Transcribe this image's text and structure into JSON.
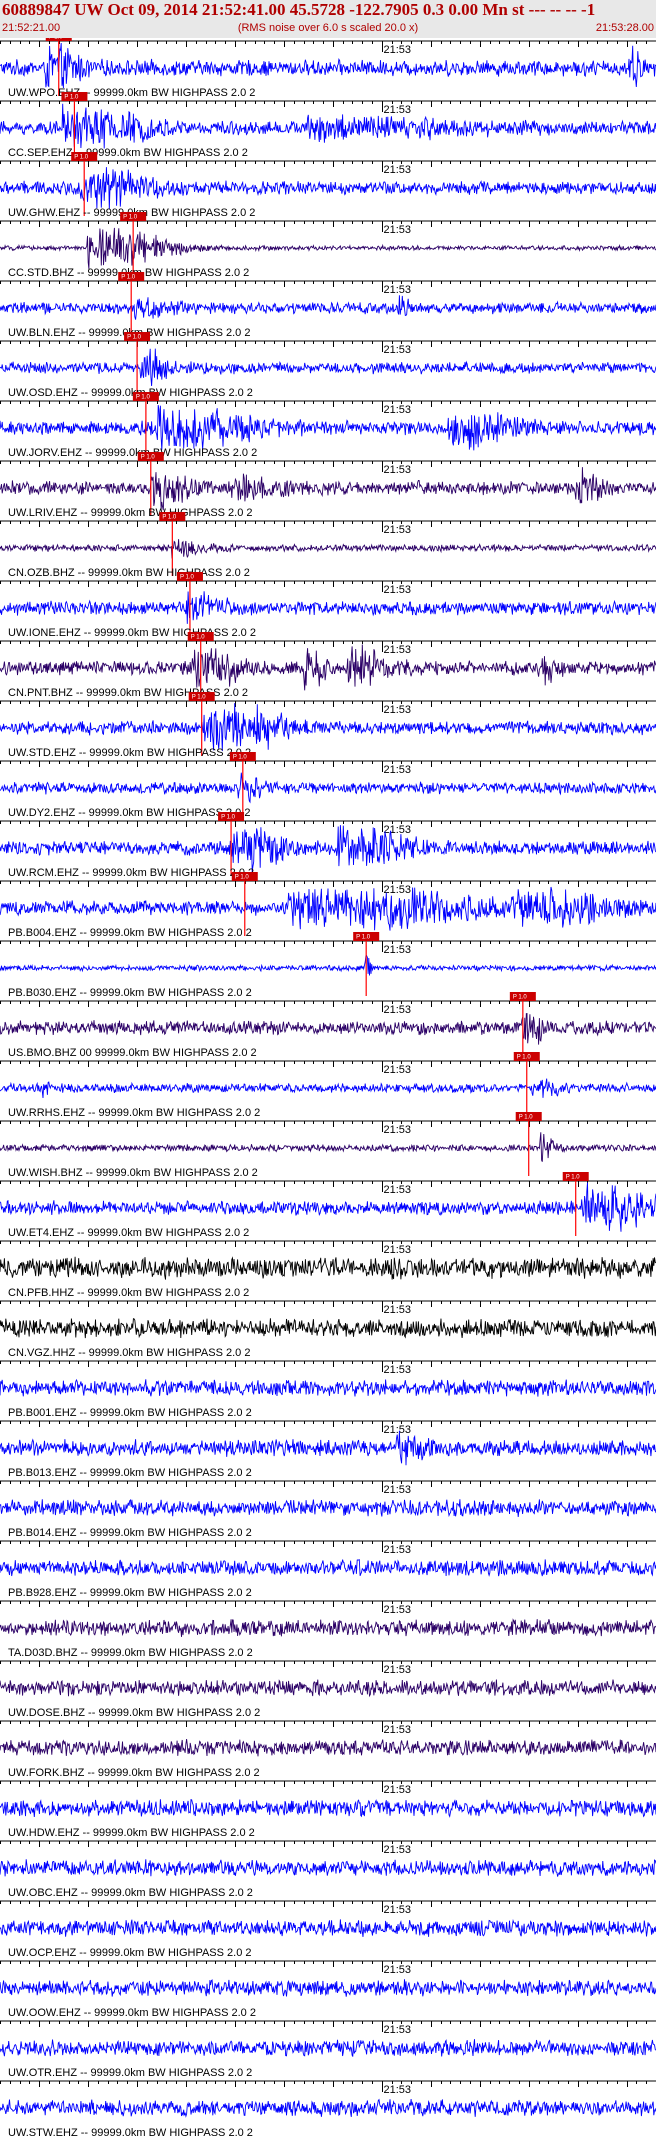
{
  "header": {
    "title": "60889847 UW Oct 09, 2014 21:52:41.00   45.5728 -122.7905  0.3 0.00 Mn st --- -- --   -1",
    "start_time": "21:52:21.00",
    "subtitle": "(RMS noise over 6.0 s scaled 20.0 x)",
    "end_time": "21:53:28.00"
  },
  "chart_data": {
    "type": "line",
    "x_range_seconds": [
      0,
      67
    ],
    "minute_mark_label": "21:53",
    "minute_mark_offset_s": 39,
    "traces": [
      {
        "label": "UW.WPO.EHZ -- 99999.0km BW  HIGHPASS  2.0  2",
        "pick_s": 6.0,
        "color": "#0000ff",
        "amp": 0.35,
        "events": [
          [
            5.5,
            1.0,
            2.5
          ],
          [
            64.5,
            1.0,
            0.8
          ]
        ]
      },
      {
        "label": "CC.SEP.EHZ -- 99999.0km BW  HIGHPASS  2.0  2",
        "pick_s": 7.6,
        "color": "#0000ff",
        "amp": 0.3,
        "events": [
          [
            8.5,
            0.8,
            6.0
          ],
          [
            35.5,
            0.35,
            12.0
          ]
        ]
      },
      {
        "label": "UW.GHW.EHZ -- 99999.0km BW  HIGHPASS  2.0  2",
        "pick_s": 8.6,
        "color": "#0000ff",
        "amp": 0.3,
        "events": [
          [
            10.0,
            0.7,
            5.0
          ]
        ]
      },
      {
        "label": "CC.STD.BHZ -- 99999.0km BW  HIGHPASS  2.0  2",
        "pick_s": 13.6,
        "color": "#2b0066",
        "amp": 0.1,
        "events": [
          [
            11.0,
            0.9,
            6.0
          ]
        ]
      },
      {
        "label": "UW.BLN.EHZ -- 99999.0km BW  HIGHPASS  2.0  2",
        "pick_s": 13.4,
        "color": "#0000ff",
        "amp": 0.25,
        "events": [
          [
            14.8,
            0.35,
            3.0
          ],
          [
            41.0,
            0.3,
            1.0
          ]
        ]
      },
      {
        "label": "UW.OSD.EHZ -- 99999.0km BW  HIGHPASS  2.0  2",
        "pick_s": 14.0,
        "color": "#0000ff",
        "amp": 0.25,
        "events": [
          [
            15.0,
            0.9,
            2.0
          ]
        ]
      },
      {
        "label": "UW.JORV.EHZ -- 99999.0km BW  HIGHPASS  2.0  2",
        "pick_s": 14.9,
        "color": "#0000ff",
        "amp": 0.3,
        "events": [
          [
            18.5,
            1.0,
            7.0
          ],
          [
            47.5,
            0.6,
            5.0
          ]
        ]
      },
      {
        "label": "UW.LRIV.EHZ -- 99999.0km BW  HIGHPASS  2.0  2",
        "pick_s": 15.4,
        "color": "#2b0066",
        "amp": 0.3,
        "events": [
          [
            16.5,
            0.6,
            3.0
          ],
          [
            25.0,
            0.35,
            4.0
          ],
          [
            59.5,
            0.7,
            2.0
          ]
        ]
      },
      {
        "label": "CN.OZB.BHZ -- 99999.0km BW  HIGHPASS  2.0  2",
        "pick_s": 17.6,
        "color": "#2b0066",
        "amp": 0.15,
        "events": [
          [
            18.5,
            0.3,
            3.0
          ]
        ]
      },
      {
        "label": "UW.IONE.EHZ -- 99999.0km BW  HIGHPASS  2.0  2",
        "pick_s": 19.4,
        "color": "#0000ff",
        "amp": 0.3,
        "events": [
          [
            20.0,
            0.5,
            3.0
          ]
        ]
      },
      {
        "label": "CN.PNT.BHZ -- 99999.0km BW  HIGHPASS  2.0  2",
        "pick_s": 20.5,
        "color": "#2b0066",
        "amp": 0.3,
        "events": [
          [
            21.0,
            0.7,
            4.0
          ],
          [
            31.5,
            0.9,
            1.5
          ],
          [
            36.5,
            0.9,
            3.0
          ],
          [
            55.5,
            0.5,
            1.5
          ]
        ]
      },
      {
        "label": "UW.STD.EHZ -- 99999.0km BW  HIGHPASS  2.0  2",
        "pick_s": 20.6,
        "color": "#0000ff",
        "amp": 0.3,
        "events": [
          [
            22.0,
            1.0,
            3.5
          ],
          [
            27.0,
            0.5,
            3.0
          ]
        ]
      },
      {
        "label": "UW.DY2.EHZ -- 99999.0km BW  HIGHPASS  2.0  2",
        "pick_s": 24.8,
        "color": "#0000ff",
        "amp": 0.25,
        "events": [
          [
            25.0,
            0.4,
            2.0
          ]
        ]
      },
      {
        "label": "UW.RCM.EHZ -- 99999.0km BW  HIGHPASS  2.0  2",
        "pick_s": 23.6,
        "color": "#0000ff",
        "amp": 0.3,
        "events": [
          [
            25.0,
            1.0,
            4.0
          ],
          [
            36.0,
            0.9,
            5.0
          ]
        ]
      },
      {
        "label": "PB.B004.EHZ -- 99999.0km BW  HIGHPASS  2.0  2",
        "pick_s": 25.0,
        "color": "#0000ff",
        "amp": 0.3,
        "events": [
          [
            34.0,
            1.0,
            13.0
          ],
          [
            55.0,
            0.6,
            8.0
          ]
        ]
      },
      {
        "label": "PB.B030.EHZ -- 99999.0km BW  HIGHPASS  2.0  2",
        "pick_s": 37.4,
        "color": "#0000ff",
        "amp": 0.12,
        "events": [
          [
            37.4,
            0.7,
            0.5
          ]
        ]
      },
      {
        "label": "US.BMO.BHZ 00 99999.0km BW  HIGHPASS  2.0  2",
        "pick_s": 53.4,
        "color": "#2b0066",
        "amp": 0.3,
        "events": [
          [
            54.0,
            0.6,
            2.0
          ]
        ]
      },
      {
        "label": "UW.RRHS.EHZ -- 99999.0km BW  HIGHPASS  2.0  2",
        "pick_s": 53.8,
        "color": "#0000ff",
        "amp": 0.2,
        "events": [
          [
            4.5,
            0.5,
            0.4
          ],
          [
            55.0,
            0.3,
            2.0
          ]
        ]
      },
      {
        "label": "UW.WISH.BHZ -- 99999.0km BW  HIGHPASS  2.0  2",
        "pick_s": 54.0,
        "color": "#2b0066",
        "amp": 0.15,
        "events": [
          [
            55.5,
            0.7,
            1.0
          ]
        ]
      },
      {
        "label": "UW.ET4.EHZ -- 99999.0km BW  HIGHPASS  2.0  2",
        "pick_s": 58.8,
        "color": "#0000ff",
        "amp": 0.3,
        "events": [
          [
            61.5,
            0.9,
            6.0
          ]
        ]
      },
      {
        "label": "CN.PFB.HHZ -- 99999.0km BW  HIGHPASS  2.0  2",
        "pick_s": null,
        "color": "#000000",
        "amp": 0.45,
        "events": []
      },
      {
        "label": "CN.VGZ.HHZ -- 99999.0km BW  HIGHPASS  2.0  2",
        "pick_s": null,
        "color": "#000000",
        "amp": 0.4,
        "events": []
      },
      {
        "label": "PB.B001.EHZ -- 99999.0km BW  HIGHPASS  2.0  2",
        "pick_s": null,
        "color": "#0000ff",
        "amp": 0.35,
        "events": []
      },
      {
        "label": "PB.B013.EHZ -- 99999.0km BW  HIGHPASS  2.0  2",
        "pick_s": null,
        "color": "#0000ff",
        "amp": 0.35,
        "events": [
          [
            41.0,
            0.5,
            2.0
          ]
        ]
      },
      {
        "label": "PB.B014.EHZ -- 99999.0km BW  HIGHPASS  2.0  2",
        "pick_s": null,
        "color": "#0000ff",
        "amp": 0.35,
        "events": []
      },
      {
        "label": "PB.B928.EHZ -- 99999.0km BW  HIGHPASS  2.0  2",
        "pick_s": null,
        "color": "#0000ff",
        "amp": 0.35,
        "events": []
      },
      {
        "label": "TA.D03D.BHZ -- 99999.0km BW  HIGHPASS  2.0  2",
        "pick_s": null,
        "color": "#2b0066",
        "amp": 0.35,
        "events": []
      },
      {
        "label": "UW.DOSE.BHZ -- 99999.0km BW  HIGHPASS  2.0  2",
        "pick_s": null,
        "color": "#2b0066",
        "amp": 0.35,
        "events": []
      },
      {
        "label": "UW.FORK.BHZ -- 99999.0km BW  HIGHPASS  2.0  2",
        "pick_s": null,
        "color": "#2b0066",
        "amp": 0.35,
        "events": []
      },
      {
        "label": "UW.HDW.EHZ -- 99999.0km BW  HIGHPASS  2.0  2",
        "pick_s": null,
        "color": "#0000ff",
        "amp": 0.35,
        "events": []
      },
      {
        "label": "UW.OBC.EHZ -- 99999.0km BW  HIGHPASS  2.0  2",
        "pick_s": null,
        "color": "#0000ff",
        "amp": 0.35,
        "events": []
      },
      {
        "label": "UW.OCP.EHZ -- 99999.0km BW  HIGHPASS  2.0  2",
        "pick_s": null,
        "color": "#0000ff",
        "amp": 0.35,
        "events": []
      },
      {
        "label": "UW.OOW.EHZ -- 99999.0km BW  HIGHPASS  2.0  2",
        "pick_s": null,
        "color": "#0000ff",
        "amp": 0.35,
        "events": []
      },
      {
        "label": "UW.OTR.EHZ -- 99999.0km BW  HIGHPASS  2.0  2",
        "pick_s": null,
        "color": "#0000ff",
        "amp": 0.35,
        "events": []
      },
      {
        "label": "UW.STW.EHZ -- 99999.0km BW  HIGHPASS  2.0  2",
        "pick_s": null,
        "color": "#0000ff",
        "amp": 0.35,
        "events": []
      }
    ],
    "pick_color": "#ff0000",
    "pick_label_bg": "#cc0000",
    "pick_label": "P 1.0"
  }
}
